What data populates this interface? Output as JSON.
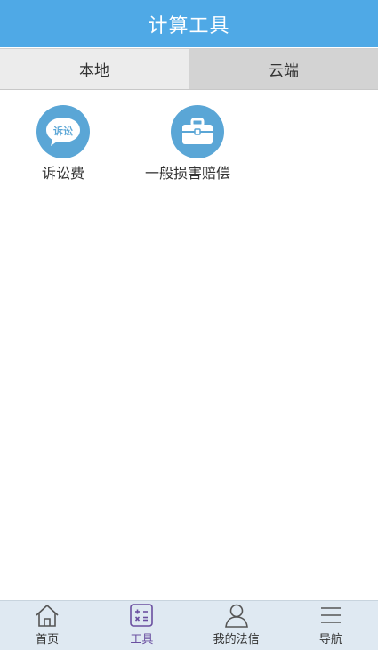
{
  "header": {
    "title": "计算工具"
  },
  "tabs": [
    {
      "label": "本地",
      "active": true
    },
    {
      "label": "云端",
      "active": false
    }
  ],
  "tools": [
    {
      "label": "诉讼费",
      "icon": "lawsuit-speech-bubble-icon",
      "icon_text": "诉讼"
    },
    {
      "label": "一般损害赔偿",
      "icon": "briefcase-icon"
    }
  ],
  "bottom_nav": [
    {
      "label": "首页",
      "icon": "home-icon",
      "active": false
    },
    {
      "label": "工具",
      "icon": "calculator-icon",
      "active": true
    },
    {
      "label": "我的法信",
      "icon": "user-icon",
      "active": false
    },
    {
      "label": "导航",
      "icon": "menu-icon",
      "active": false
    }
  ],
  "colors": {
    "header_bg": "#4fa9e6",
    "tool_icon_bg": "#5aa6d6",
    "active_nav": "#6a4fa0",
    "nav_bg": "#dfe9f2"
  }
}
